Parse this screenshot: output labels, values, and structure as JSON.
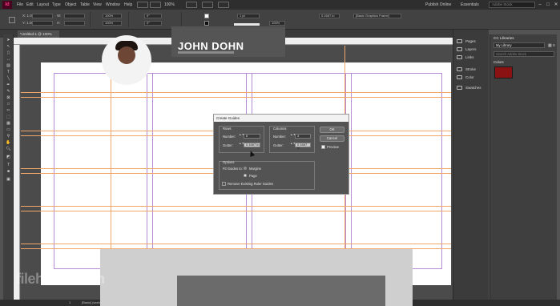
{
  "app": {
    "logo": "Id"
  },
  "menubar": {
    "items": [
      "File",
      "Edit",
      "Layout",
      "Type",
      "Object",
      "Table",
      "View",
      "Window",
      "Help"
    ],
    "zoom": "100%",
    "publish_online": "Publish Online",
    "workspace": "Essentials",
    "stock_search_placeholder": "Adobe Stock"
  },
  "controlbar": {
    "x": "X: 1.00 in",
    "y": "Y: 1.00 in",
    "w": "W:",
    "h": "H:",
    "zoom_pct_1": "100%",
    "zoom_pct_2": "100%",
    "stroke_weight": "1 pt",
    "angle": "0°",
    "shear": "0°",
    "opacity": "100%",
    "ref": "0.1667 in",
    "frame_style": "[Basic Graphics Frame]"
  },
  "document": {
    "tab_label": "*Untitled-1 @ 100%"
  },
  "dialog": {
    "title": "Create Guides",
    "rows_label": "Rows",
    "columns_label": "Columns",
    "number_label": "Number:",
    "gutter_label": "Gutter:",
    "rows_number": "6",
    "rows_gutter": "0.1667 in",
    "columns_number": "4",
    "columns_gutter": "0.1667 in",
    "ok": "OK",
    "cancel": "Cancel",
    "preview": "Preview",
    "options_label": "Options",
    "fit_label": "Fit Guides to:",
    "margins": "Margins",
    "page": "Page",
    "remove_existing": "Remove Existing Ruler Guides"
  },
  "dock": {
    "items": [
      "Pages",
      "Layers",
      "Links",
      "Stroke",
      "Color",
      "Swatches"
    ]
  },
  "cc_libraries": {
    "title": "CC Libraries",
    "library": "My Library",
    "search_placeholder": "Search Adobe Stock",
    "section": "Colors",
    "swatch_color": "#8b1212"
  },
  "card": {
    "name": "JOHN DOHN"
  },
  "statusbar": {
    "page": "1",
    "style": "[Basic] (working)"
  },
  "watermark": "filehorse.com",
  "colors": {
    "guide_orange": "#f1a66a",
    "margin_purple": "#b48bd4",
    "ui_dark": "#2e2e2e"
  }
}
